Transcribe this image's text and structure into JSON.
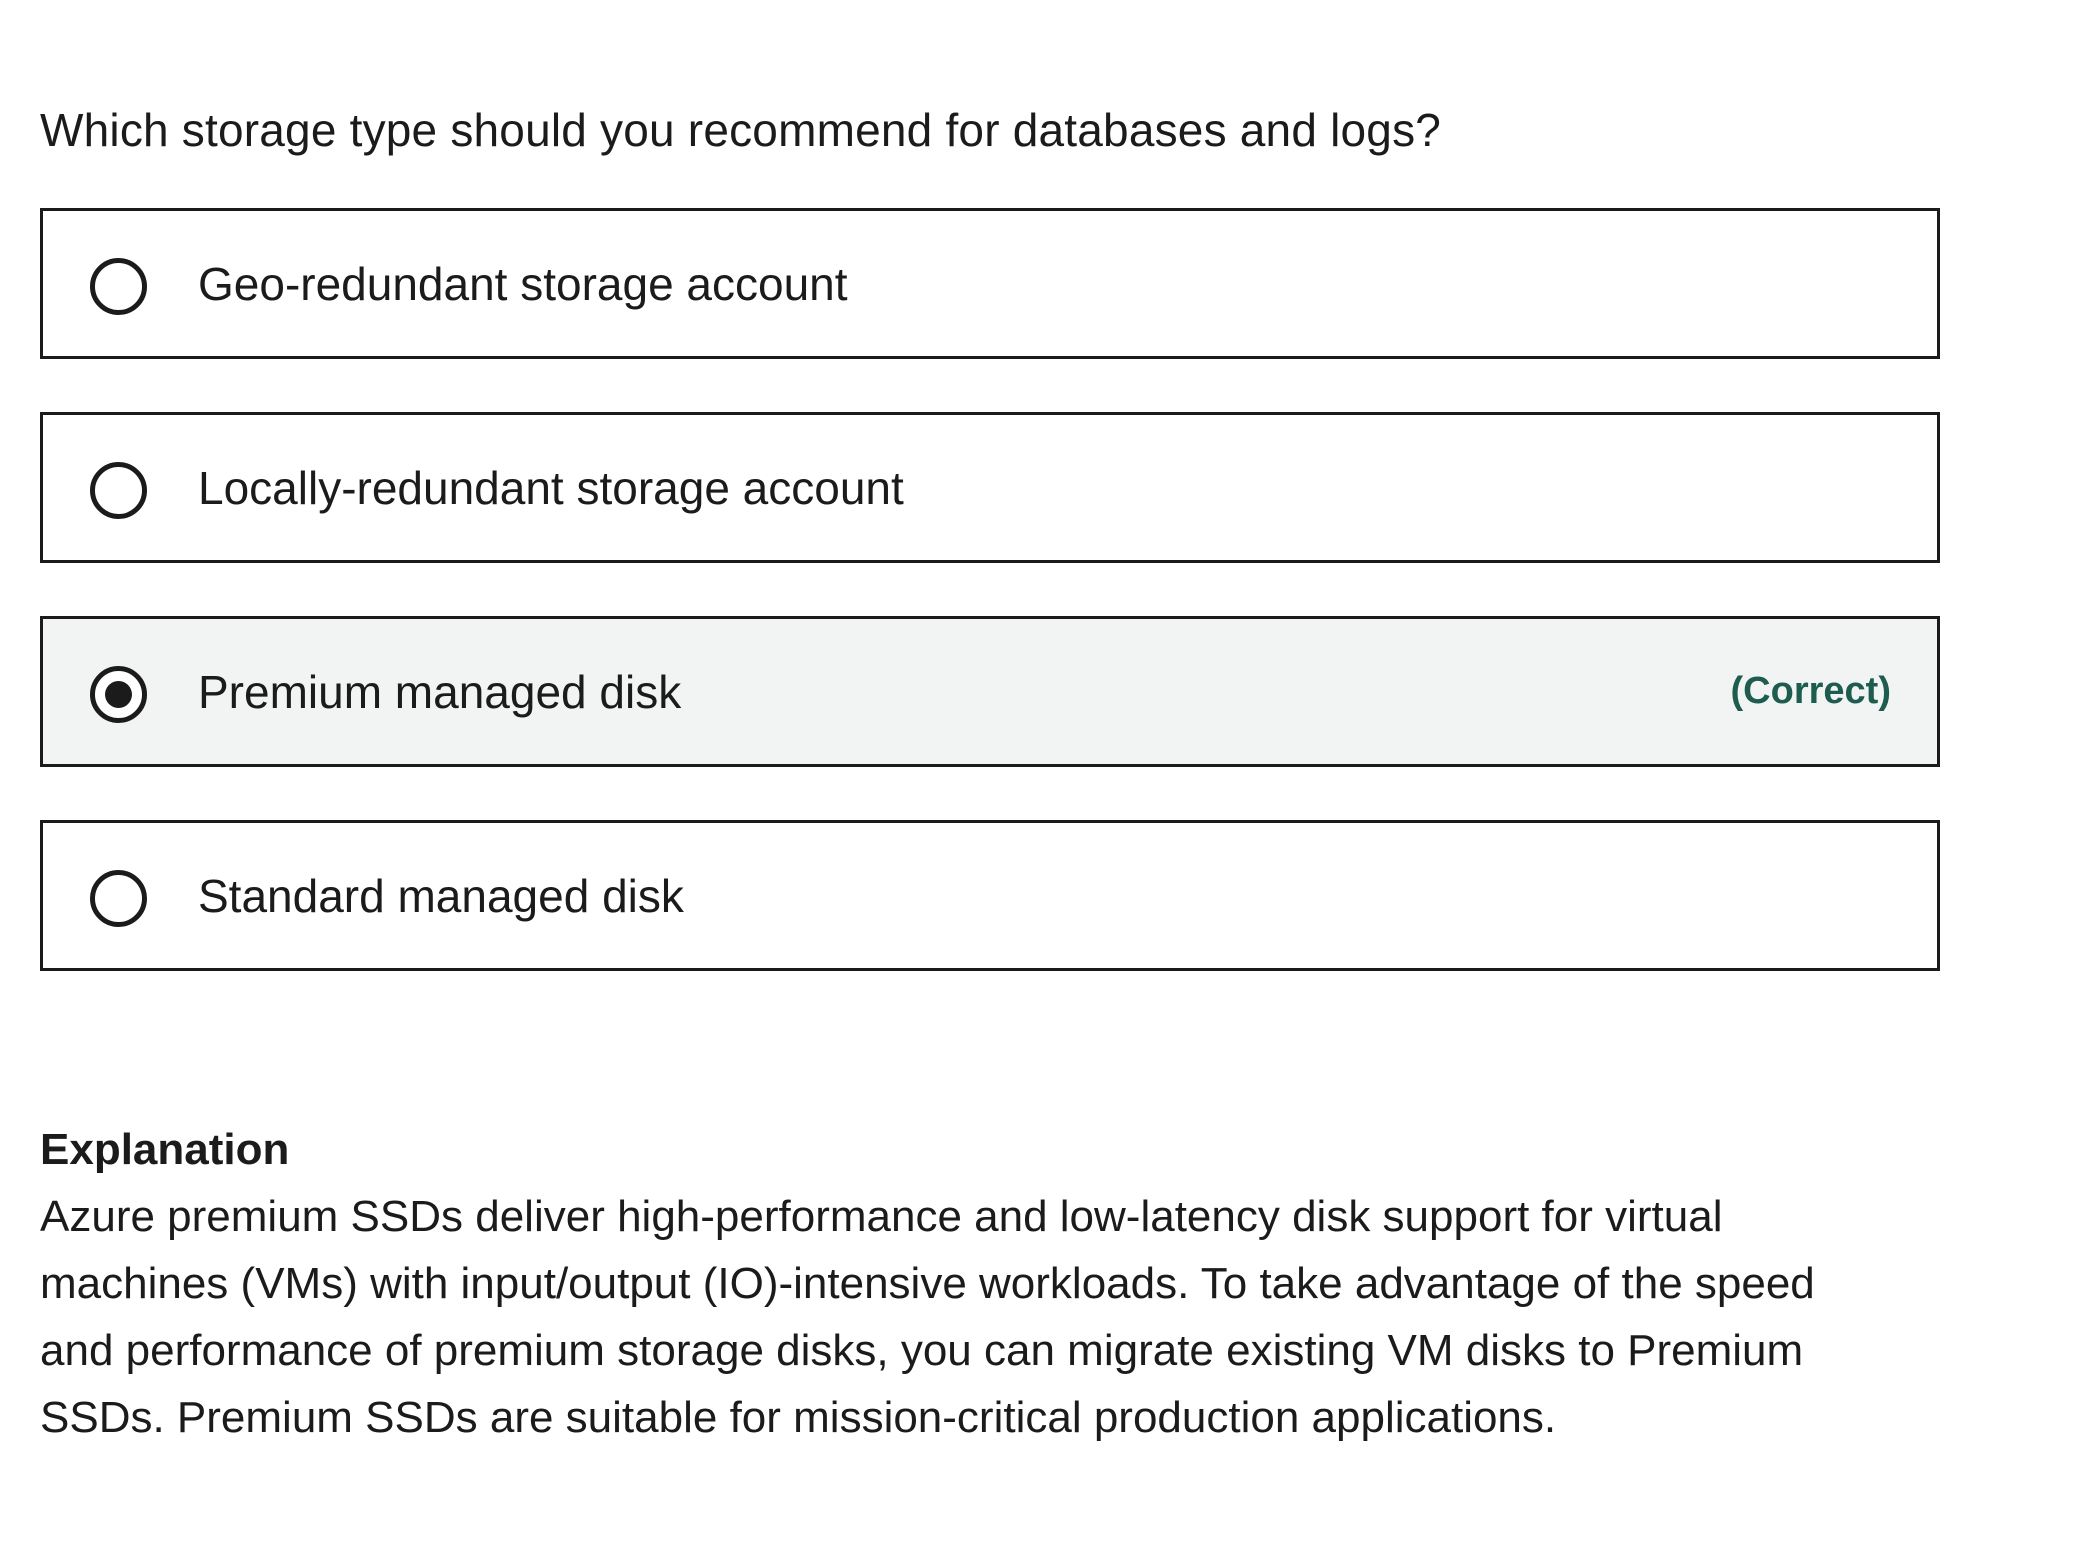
{
  "question": {
    "text": "Which storage type should you recommend for databases and logs?"
  },
  "options": [
    {
      "label": "Geo-redundant storage account",
      "selected": false
    },
    {
      "label": "Locally-redundant storage account",
      "selected": false
    },
    {
      "label": "Premium managed disk",
      "selected": true,
      "verdict": "(Correct)"
    },
    {
      "label": "Standard managed disk",
      "selected": false
    }
  ],
  "explanation": {
    "title": "Explanation",
    "body": "Azure premium SSDs deliver high-performance and low-latency disk support for virtual machines (VMs) with input/output (IO)-intensive workloads. To take advantage of the speed and performance of premium storage disks, you can migrate existing VM disks to Premium SSDs. Premium SSDs are suitable for mission-critical production applications."
  },
  "colors": {
    "selected_background": "#f1f4f3",
    "correct_text": "#1d5c4e",
    "border": "#1b1b1b"
  },
  "icons": {
    "radio_unselected": "radio-unselected-icon",
    "radio_selected": "radio-selected-icon"
  }
}
